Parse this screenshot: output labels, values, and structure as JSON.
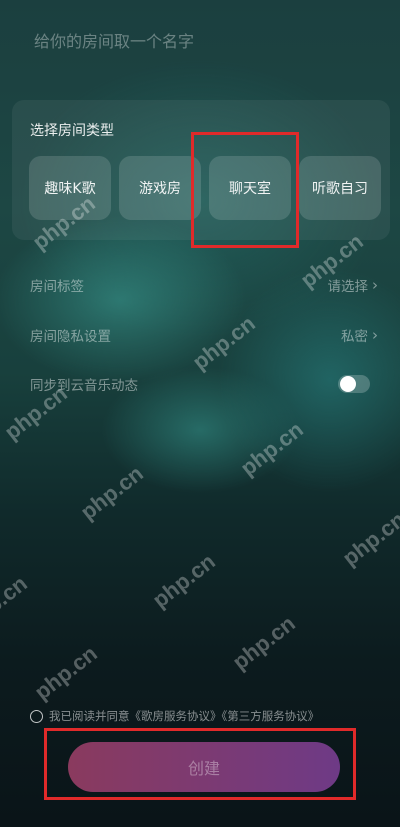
{
  "room_name": {
    "placeholder": "给你的房间取一个名字"
  },
  "room_type": {
    "title": "选择房间类型",
    "options": [
      "趣味K歌",
      "游戏房",
      "聊天室",
      "听歌自习"
    ]
  },
  "settings": [
    {
      "label": "房间标签",
      "value": "请选择"
    },
    {
      "label": "房间隐私设置",
      "value": "私密"
    },
    {
      "label": "同步到云音乐动态"
    }
  ],
  "sync_toggle": {
    "on": false
  },
  "agreement": {
    "text": "我已阅读并同意《歌房服务协议》《第三方服务协议》"
  },
  "create_button": {
    "label": "创建"
  },
  "watermark": {
    "text": "php.cn"
  },
  "colors": {
    "highlight": "#e02a2a",
    "button_start": "#8a3a5e",
    "button_end": "#6e3a86"
  }
}
